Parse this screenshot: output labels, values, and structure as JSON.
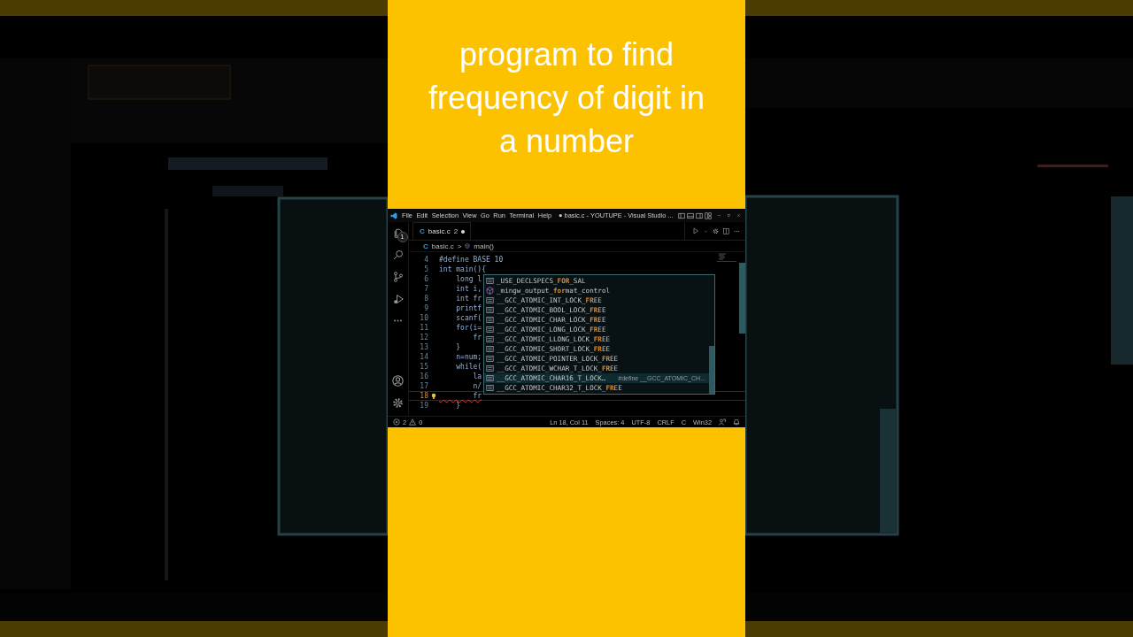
{
  "title": "program to find\nfrequency of digit in\na number",
  "window": {
    "menu": [
      "File",
      "Edit",
      "Selection",
      "View",
      "Go",
      "Run",
      "Terminal",
      "Help"
    ],
    "title": "● basic.c - YOUTUPE - Visual Studio ...",
    "explorer_badge": "1",
    "tabs": [
      {
        "file_icon": "C",
        "name": "basic.c",
        "problems": "2",
        "dirty": true,
        "selected": true
      }
    ],
    "breadcrumb": {
      "file_icon": "C",
      "file": "basic.c",
      "separator": ">",
      "symbol": "main()"
    },
    "code_lines": [
      {
        "number": "4",
        "code": "#define BASE 10",
        "current": false,
        "error": false,
        "lightbulb": false
      },
      {
        "number": "5",
        "code": "int main(){",
        "current": false,
        "error": false,
        "lightbulb": false
      },
      {
        "number": "6",
        "code": "    long l",
        "current": false,
        "error": false,
        "lightbulb": false
      },
      {
        "number": "7",
        "code": "    int i,",
        "current": false,
        "error": false,
        "lightbulb": false
      },
      {
        "number": "8",
        "code": "    int fr",
        "current": false,
        "error": false,
        "lightbulb": false
      },
      {
        "number": "9",
        "code": "    printf",
        "current": false,
        "error": false,
        "lightbulb": false
      },
      {
        "number": "10",
        "code": "    scanf(",
        "current": false,
        "error": false,
        "lightbulb": false
      },
      {
        "number": "11",
        "code": "    for(i=",
        "current": false,
        "error": false,
        "lightbulb": false
      },
      {
        "number": "12",
        "code": "        fr",
        "current": false,
        "error": false,
        "lightbulb": false
      },
      {
        "number": "13",
        "code": "    }",
        "current": false,
        "error": false,
        "lightbulb": false
      },
      {
        "number": "14",
        "code": "    n=num;",
        "current": false,
        "error": false,
        "lightbulb": false
      },
      {
        "number": "15",
        "code": "    while(",
        "current": false,
        "error": false,
        "lightbulb": false
      },
      {
        "number": "16",
        "code": "        la",
        "current": false,
        "error": false,
        "lightbulb": false
      },
      {
        "number": "17",
        "code": "        n/",
        "current": false,
        "error": false,
        "lightbulb": false
      },
      {
        "number": "18",
        "code": "        fr",
        "current": true,
        "error": true,
        "lightbulb": true
      },
      {
        "number": "19",
        "code": "    }",
        "current": false,
        "error": false,
        "lightbulb": false
      }
    ],
    "suggestions": [
      {
        "kind": "constant",
        "parts": [
          {
            "text": "_USE_DECLSPECS_",
            "match": false
          },
          {
            "text": "FOR",
            "match": true
          },
          {
            "text": "_SAL",
            "match": false
          }
        ],
        "selected": false
      },
      {
        "kind": "module",
        "parts": [
          {
            "text": "_mingw_output_",
            "match": false
          },
          {
            "text": "for",
            "match": true
          },
          {
            "text": "mat_control",
            "match": false
          }
        ],
        "selected": false
      },
      {
        "kind": "constant",
        "parts": [
          {
            "text": "__GCC_ATOMIC_INT_LOCK_",
            "match": false
          },
          {
            "text": "FR",
            "match": true
          },
          {
            "text": "EE",
            "match": false
          }
        ],
        "selected": false
      },
      {
        "kind": "constant",
        "parts": [
          {
            "text": "__GCC_ATOMIC_BOOL_LOCK_",
            "match": false
          },
          {
            "text": "FR",
            "match": true
          },
          {
            "text": "EE",
            "match": false
          }
        ],
        "selected": false
      },
      {
        "kind": "constant",
        "parts": [
          {
            "text": "__GCC_ATOMIC_CHAR_LOCK_",
            "match": false
          },
          {
            "text": "FR",
            "match": true
          },
          {
            "text": "EE",
            "match": false
          }
        ],
        "selected": false
      },
      {
        "kind": "constant",
        "parts": [
          {
            "text": "__GCC_ATOMIC_LONG_LOCK_",
            "match": false
          },
          {
            "text": "FR",
            "match": true
          },
          {
            "text": "EE",
            "match": false
          }
        ],
        "selected": false
      },
      {
        "kind": "constant",
        "parts": [
          {
            "text": "__GCC_ATOMIC_LLONG_LOCK_",
            "match": false
          },
          {
            "text": "FR",
            "match": true
          },
          {
            "text": "EE",
            "match": false
          }
        ],
        "selected": false
      },
      {
        "kind": "constant",
        "parts": [
          {
            "text": "__GCC_ATOMIC_SHORT_LOCK_",
            "match": false
          },
          {
            "text": "FR",
            "match": true
          },
          {
            "text": "EE",
            "match": false
          }
        ],
        "selected": false
      },
      {
        "kind": "constant",
        "parts": [
          {
            "text": "__GCC_ATOMIC_POINTER_LOCK_",
            "match": false
          },
          {
            "text": "FR",
            "match": true
          },
          {
            "text": "EE",
            "match": false
          }
        ],
        "selected": false
      },
      {
        "kind": "constant",
        "parts": [
          {
            "text": "__GCC_ATOMIC_WCHAR_T_LOCK_",
            "match": false
          },
          {
            "text": "FR",
            "match": true
          },
          {
            "text": "EE",
            "match": false
          }
        ],
        "selected": false
      },
      {
        "kind": "constant",
        "parts": [
          {
            "text": "__GCC_ATOMIC_CHAR16_T_LOCK…",
            "match": false
          }
        ],
        "detail": "#define __GCC_ATOMIC_CH…",
        "selected": true
      },
      {
        "kind": "constant",
        "parts": [
          {
            "text": "__GCC_ATOMIC_CHAR32_T_LOCK_",
            "match": false
          },
          {
            "text": "FR",
            "match": true
          },
          {
            "text": "EE",
            "match": false
          }
        ],
        "selected": false
      }
    ],
    "status_bar": {
      "errors": "2",
      "warnings": "0",
      "items": [
        "Ln 18, Col 11",
        "Spaces: 4",
        "UTF-8",
        "CRLF",
        "C",
        "Win32"
      ]
    }
  }
}
